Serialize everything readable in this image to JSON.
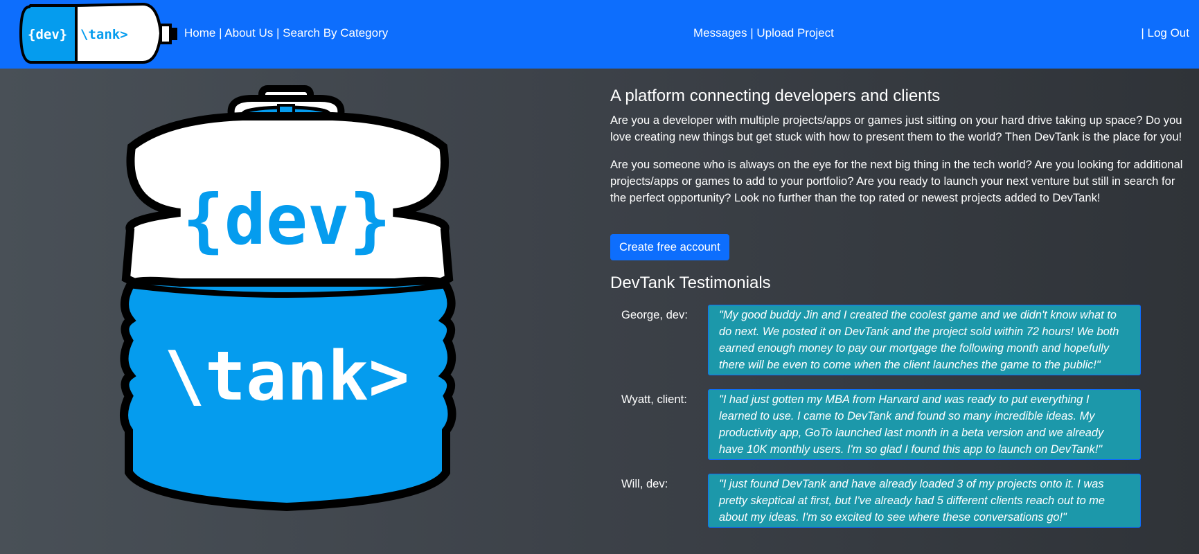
{
  "logo": {
    "dev_text": "{dev}",
    "tank_text": "\\tank>"
  },
  "nav": {
    "left": [
      "Home",
      "About Us",
      "Search By Category"
    ],
    "center": [
      "Messages",
      "Upload Project"
    ],
    "right_separator": "|",
    "logout": "Log Out"
  },
  "main": {
    "headline": "A platform connecting developers and clients",
    "paragraph1": "Are you a developer with multiple projects/apps or games just sitting on your hard drive taking up space? Do you love creating new things but get stuck with how to present them to the world? Then DevTank is the place for you!",
    "paragraph2": "Are you someone who is always on the eye for the next big thing in the tech world? Are you looking for additional projects/apps or games to add to your portfolio? Are you ready to launch your next venture but still in search for the perfect opportunity? Look no further than the top rated or newest projects added to DevTank!",
    "cta_label": "Create free account"
  },
  "testimonials": {
    "title": "DevTank Testimonials",
    "items": [
      {
        "name": "George, dev:",
        "quote": "\"My good buddy Jin and I created the coolest game and we didn't know what to do next. We posted it on DevTank and the project sold within 72 hours! We both earned enough money to pay our mortgage the following month and hopefully there will be even to come when the client launches the game to the public!\""
      },
      {
        "name": "Wyatt, client:",
        "quote": "\"I had just gotten my MBA from Harvard and was ready to put everything I learned to use. I came to DevTank and found so many incredible ideas. My productivity app, GoTo launched last month in a beta version and we already have 10K monthly users. I'm so glad I found this app to launch on DevTank!\""
      },
      {
        "name": "Will, dev:",
        "quote": "\"I just found DevTank and have already loaded 3 of my projects onto it. I was pretty skeptical at first, but I've already had 5 different clients reach out to me about my ideas. I'm so excited to see where these conversations go!\""
      }
    ]
  },
  "colors": {
    "navbar": "#0d6efd",
    "tank_blue": "#059cee",
    "testimonial_bg": "#1c98aa",
    "text": "#ffffff"
  }
}
